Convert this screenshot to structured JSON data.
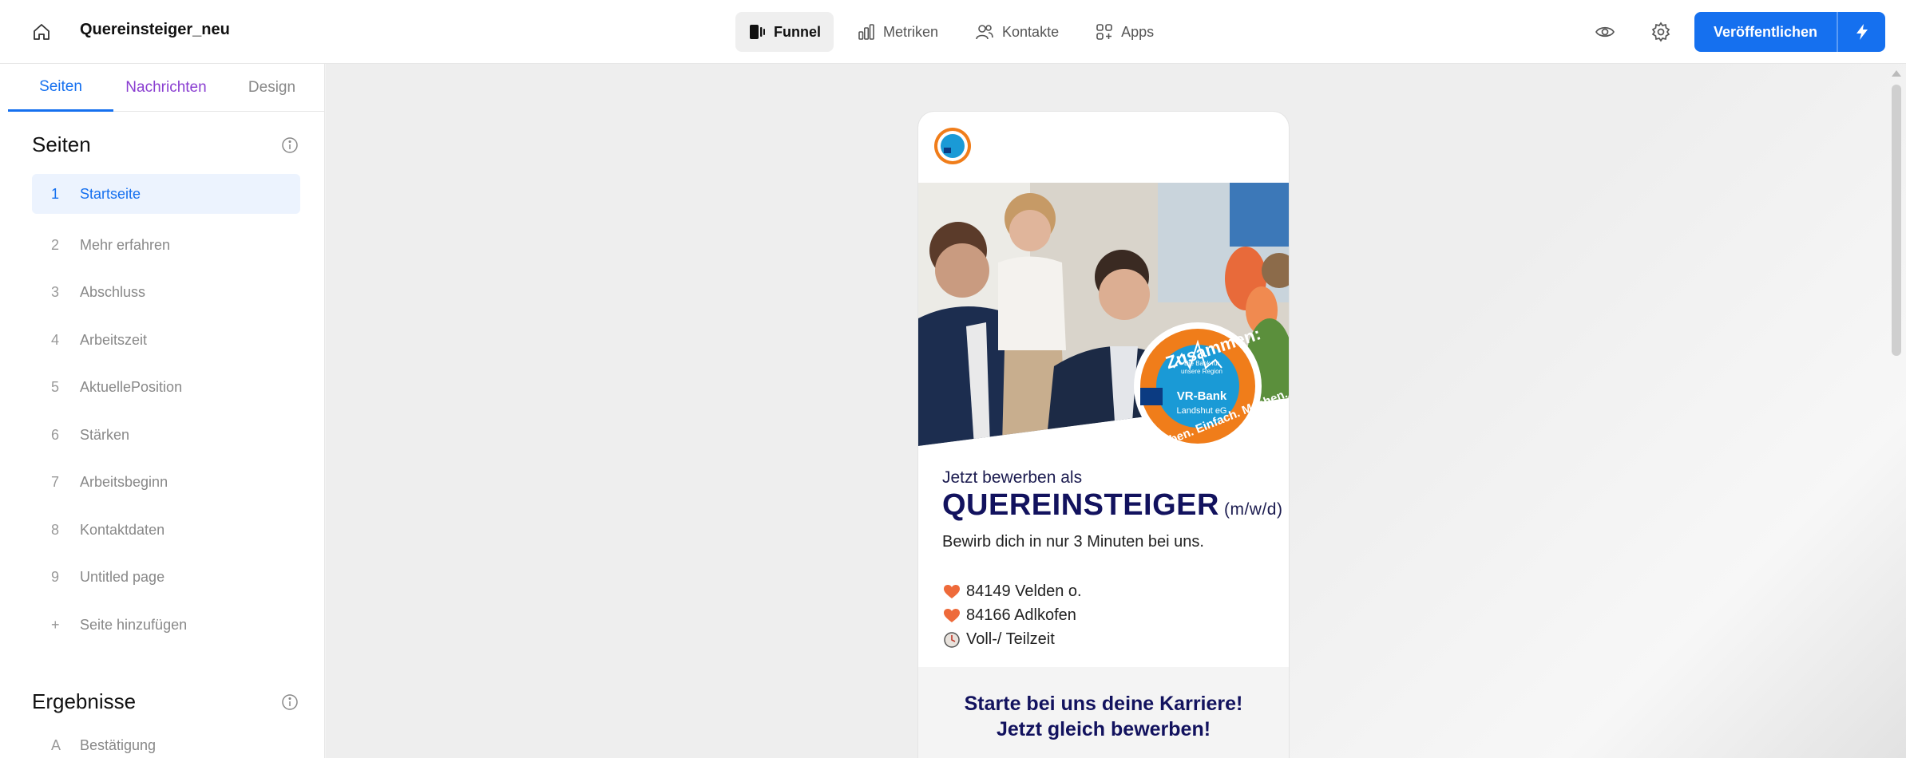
{
  "header": {
    "project_title": "Quereinsteiger_neu",
    "nav": [
      {
        "label": "Funnel",
        "icon": "funnel-icon",
        "active": true
      },
      {
        "label": "Metriken",
        "icon": "bar-chart-icon",
        "active": false
      },
      {
        "label": "Kontakte",
        "icon": "users-icon",
        "active": false
      },
      {
        "label": "Apps",
        "icon": "apps-icon",
        "active": false
      }
    ],
    "publish_label": "Veröffentlichen",
    "accent": "#1570ef"
  },
  "sidebar": {
    "tabs": [
      "Seiten",
      "Nachrichten",
      "Design"
    ],
    "pages_heading": "Seiten",
    "pages": [
      {
        "num": "1",
        "label": "Startseite",
        "active": true
      },
      {
        "num": "2",
        "label": "Mehr erfahren"
      },
      {
        "num": "3",
        "label": "Abschluss"
      },
      {
        "num": "4",
        "label": "Arbeitszeit"
      },
      {
        "num": "5",
        "label": "AktuellePosition"
      },
      {
        "num": "6",
        "label": "Stärken"
      },
      {
        "num": "7",
        "label": "Arbeitsbeginn"
      },
      {
        "num": "8",
        "label": "Kontaktdaten"
      },
      {
        "num": "9",
        "label": "Untitled page"
      },
      {
        "num": "+",
        "label": "Seite hinzufügen"
      }
    ],
    "results_heading": "Ergebnisse",
    "results": [
      {
        "num": "A",
        "label": "Bestätigung"
      }
    ]
  },
  "preview": {
    "badge_top": "Zusammen:",
    "badge_mid1": "Die Bank für",
    "badge_mid2": "unsere Region",
    "badge_bank": "VR-Bank",
    "badge_bank2": "Landshut eG",
    "badge_bottom": "Leben. Einfach. Machen.",
    "apply_as": "Jetzt bewerben als",
    "title": "QUEREINSTEIGER",
    "title_suffix": "(m/w/d)",
    "lead": "Bewirb dich in nur 3 Minuten bei uns.",
    "locations": [
      {
        "icon": "heart-icon",
        "text": "84149 Velden o."
      },
      {
        "icon": "heart-icon",
        "text": "84166 Adlkofen"
      },
      {
        "icon": "clock-icon",
        "text": "Voll-/ Teilzeit"
      }
    ],
    "cta_line1": "Starte bei uns deine Karriere!",
    "cta_line2": "Jetzt gleich bewerben!"
  }
}
